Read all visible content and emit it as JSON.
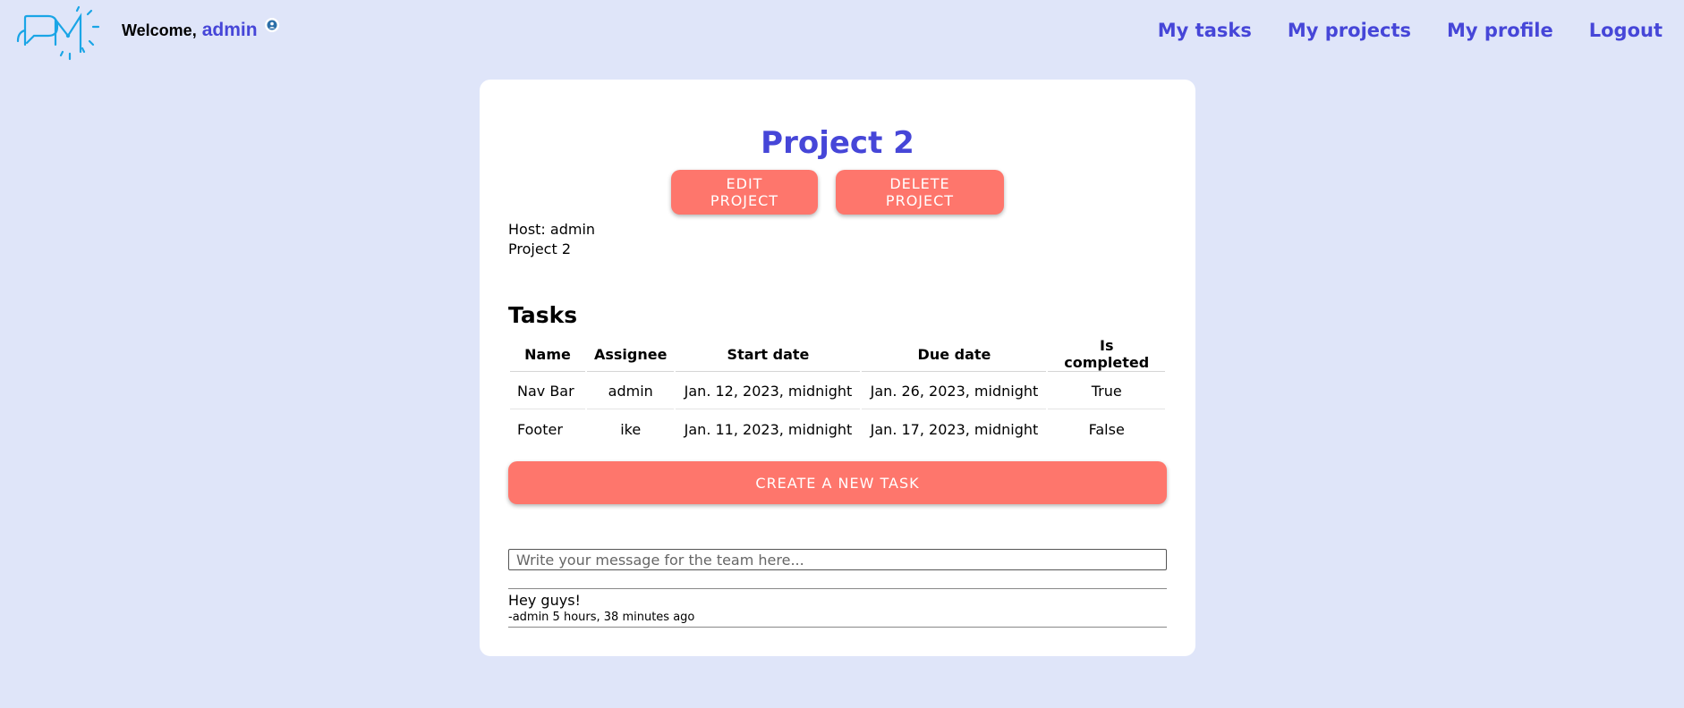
{
  "header": {
    "welcome_label": "Welcome,",
    "username": "admin",
    "nav": {
      "my_tasks": "My tasks",
      "my_projects": "My projects",
      "my_profile": "My profile",
      "logout": "Logout"
    }
  },
  "project": {
    "title": "Project 2",
    "edit_label": "EDIT PROJECT",
    "delete_label": "DELETE PROJECT",
    "host_line": "Host: admin",
    "description": "Project 2"
  },
  "tasks": {
    "heading": "Tasks",
    "columns": [
      "Name",
      "Assignee",
      "Start date",
      "Due date",
      "Is completed"
    ],
    "rows": [
      [
        "Nav Bar",
        "admin",
        "Jan. 12, 2023, midnight",
        "Jan. 26, 2023, midnight",
        "True"
      ],
      [
        "Footer",
        "ike",
        "Jan. 11, 2023, midnight",
        "Jan. 17, 2023, midnight",
        "False"
      ]
    ],
    "create_label": "CREATE A NEW TASK"
  },
  "chat": {
    "placeholder": "Write your message for the team here...",
    "value": "",
    "messages": [
      {
        "body": "Hey guys!",
        "meta": "-admin 5 hours, 38 minutes ago"
      }
    ]
  },
  "colors": {
    "background": "#dfe5f9",
    "accent": "#4646d8",
    "button": "#fe766c",
    "logo": "#1aa5e6"
  },
  "icons": {
    "logo": "pm-logo-icon",
    "user": "user-icon"
  }
}
